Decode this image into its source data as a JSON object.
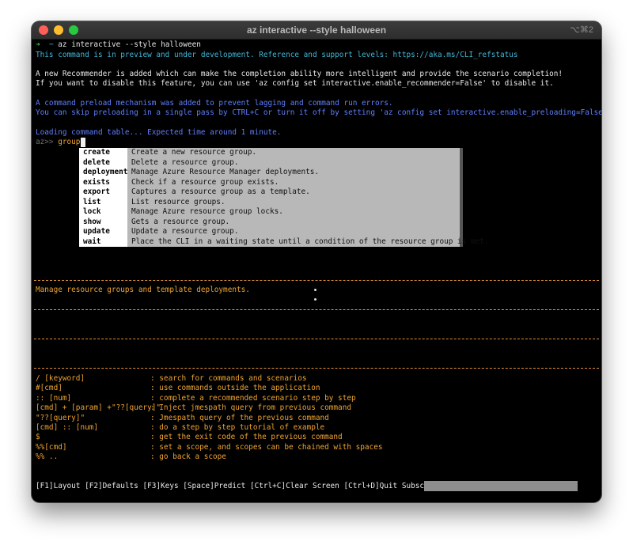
{
  "window": {
    "title": "az interactive --style halloween",
    "shortcut": "⌥⌘2"
  },
  "terminal": {
    "prompt_arrow": "➜",
    "prompt_dir": "~",
    "command": "az interactive --style halloween",
    "lines": {
      "preview": "This command is in preview and under development. Reference and support levels: https://aka.ms/CLI_refstatus",
      "recommender_1": "A new Recommender is added which can make the completion ability more intelligent and provide the scenario completion!",
      "recommender_2": "If you want to disable this feature, you can use 'az config set interactive.enable_recommender=False' to disable it.",
      "preload_1": "A command preload mechanism was added to prevent lagging and command run errors.",
      "preload_2": "You can skip preloading in a single pass by CTRL+C or turn it off by setting 'az config set interactive.enable_preloading=False'",
      "loading": "Loading command table... Expected time around 1 minute."
    },
    "input": {
      "prompt": "az>>",
      "text": "group"
    }
  },
  "completions": [
    {
      "name": "create",
      "desc": "Create a new resource group."
    },
    {
      "name": "delete",
      "desc": "Delete a resource group."
    },
    {
      "name": "deployment",
      "desc": "Manage Azure Resource Manager deployments."
    },
    {
      "name": "exists",
      "desc": "Check if a resource group exists."
    },
    {
      "name": "export",
      "desc": "Captures a resource group as a template."
    },
    {
      "name": "list",
      "desc": "List resource groups."
    },
    {
      "name": "lock",
      "desc": "Manage Azure resource group locks."
    },
    {
      "name": "show",
      "desc": "Gets a resource group."
    },
    {
      "name": "update",
      "desc": "Update a resource group."
    },
    {
      "name": "wait",
      "desc": "Place the CLI in a waiting state until a condition of the resource group is met."
    }
  ],
  "description_pane": {
    "text": "Manage resource groups and template deployments."
  },
  "help": [
    {
      "key": "/ [keyword]",
      "desc": ": search for commands and scenarios"
    },
    {
      "key": "#[cmd]",
      "desc": ": use commands outside the application"
    },
    {
      "key": ":: [num]",
      "desc": ": complete a recommended scenario step by step"
    },
    {
      "key": "[cmd] + [param] +\"??[query]\"",
      "desc": ": Inject jmespath query from previous command"
    },
    {
      "key": "\"??[query]\"",
      "desc": ": Jmespath query of the previous command"
    },
    {
      "key": "[cmd] :: [num]",
      "desc": ": do a step by step tutorial of example"
    },
    {
      "key": "$",
      "desc": ": get the exit code of the previous command"
    },
    {
      "key": "%%[cmd]",
      "desc": ": set a scope, and scopes can be chained with spaces"
    },
    {
      "key": "%% ..",
      "desc": ": go back a scope"
    }
  ],
  "toolbar": {
    "text": "[F1]Layout [F2]Defaults [F3]Keys [Space]Predict [Ctrl+C]Clear Screen [Ctrl+D]Quit Subscription:"
  },
  "colors": {
    "background": "#000000",
    "preview_cyan": "#3fb9d8",
    "notice_blue": "#5f7fff",
    "prompt_green": "#3ec53e",
    "halloween_orange": "#f0a431"
  }
}
